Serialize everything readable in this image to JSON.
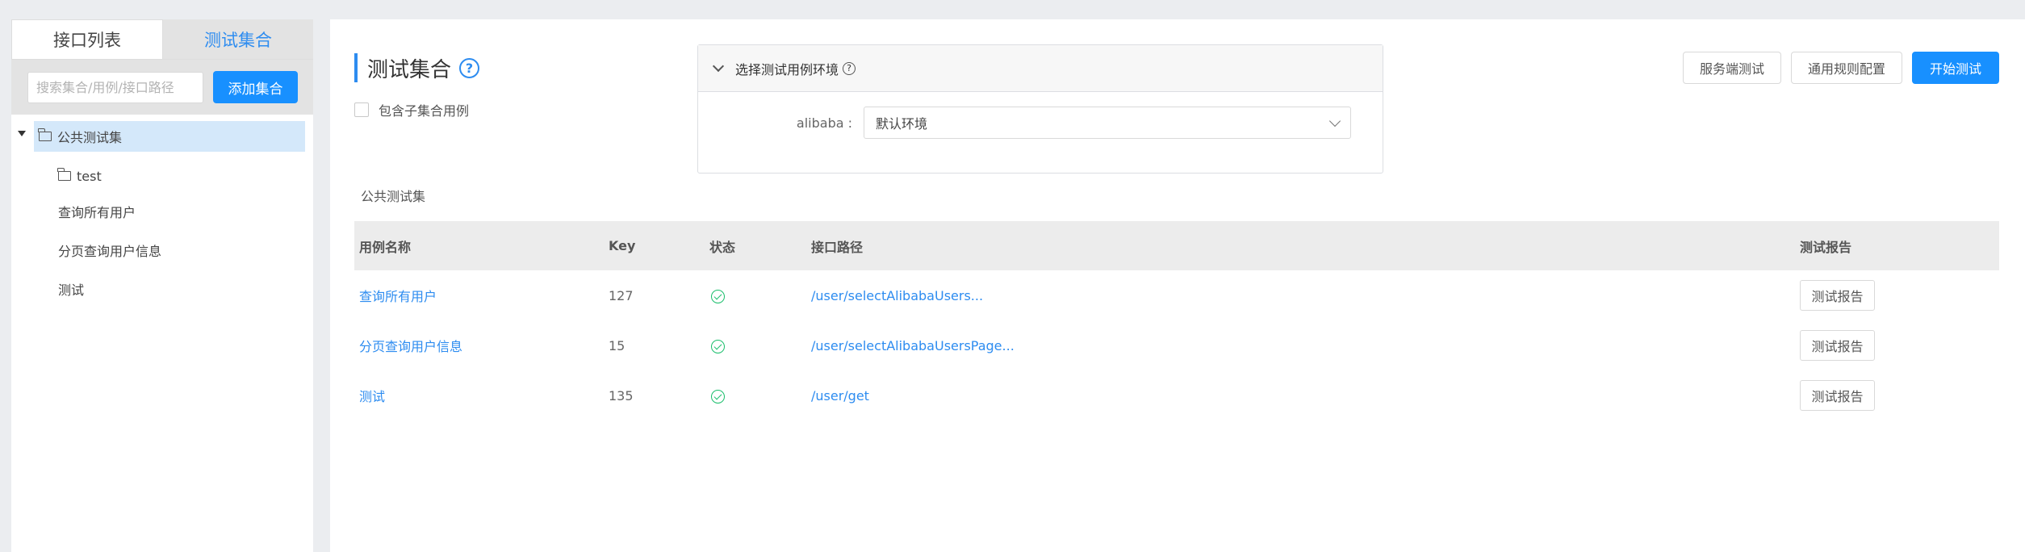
{
  "left": {
    "tabs": [
      {
        "label": "接口列表"
      },
      {
        "label": "测试集合"
      }
    ],
    "search_placeholder": "搜索集合/用例/接口路径",
    "add_label": "添加集合",
    "tree": {
      "root": "公共测试集",
      "folder": "test",
      "leaves": [
        "查询所有用户",
        "分页查询用户信息",
        "测试"
      ]
    }
  },
  "main": {
    "title": "测试集合",
    "help_symbol": "?",
    "include_children": "包含子集合用例",
    "env": {
      "header": "选择测试用例环境",
      "label": "alibaba :",
      "value": "默认环境"
    },
    "buttons": {
      "server_test": "服务端测试",
      "rule_config": "通用规则配置",
      "start_test": "开始测试"
    },
    "section": "公共测试集",
    "table": {
      "headers": [
        "用例名称",
        "Key",
        "状态",
        "接口路径",
        "测试报告"
      ],
      "rows": [
        {
          "name": "查询所有用户",
          "key": "127",
          "path": "/user/selectAlibabaUsers...",
          "report": "测试报告"
        },
        {
          "name": "分页查询用户信息",
          "key": "15",
          "path": "/user/selectAlibabaUsersPage...",
          "report": "测试报告"
        },
        {
          "name": "测试",
          "key": "135",
          "path": "/user/get",
          "report": "测试报告"
        }
      ]
    }
  },
  "colors": {
    "accent": "#1890ff",
    "link": "#2d8cf0",
    "success": "#19be6b"
  }
}
